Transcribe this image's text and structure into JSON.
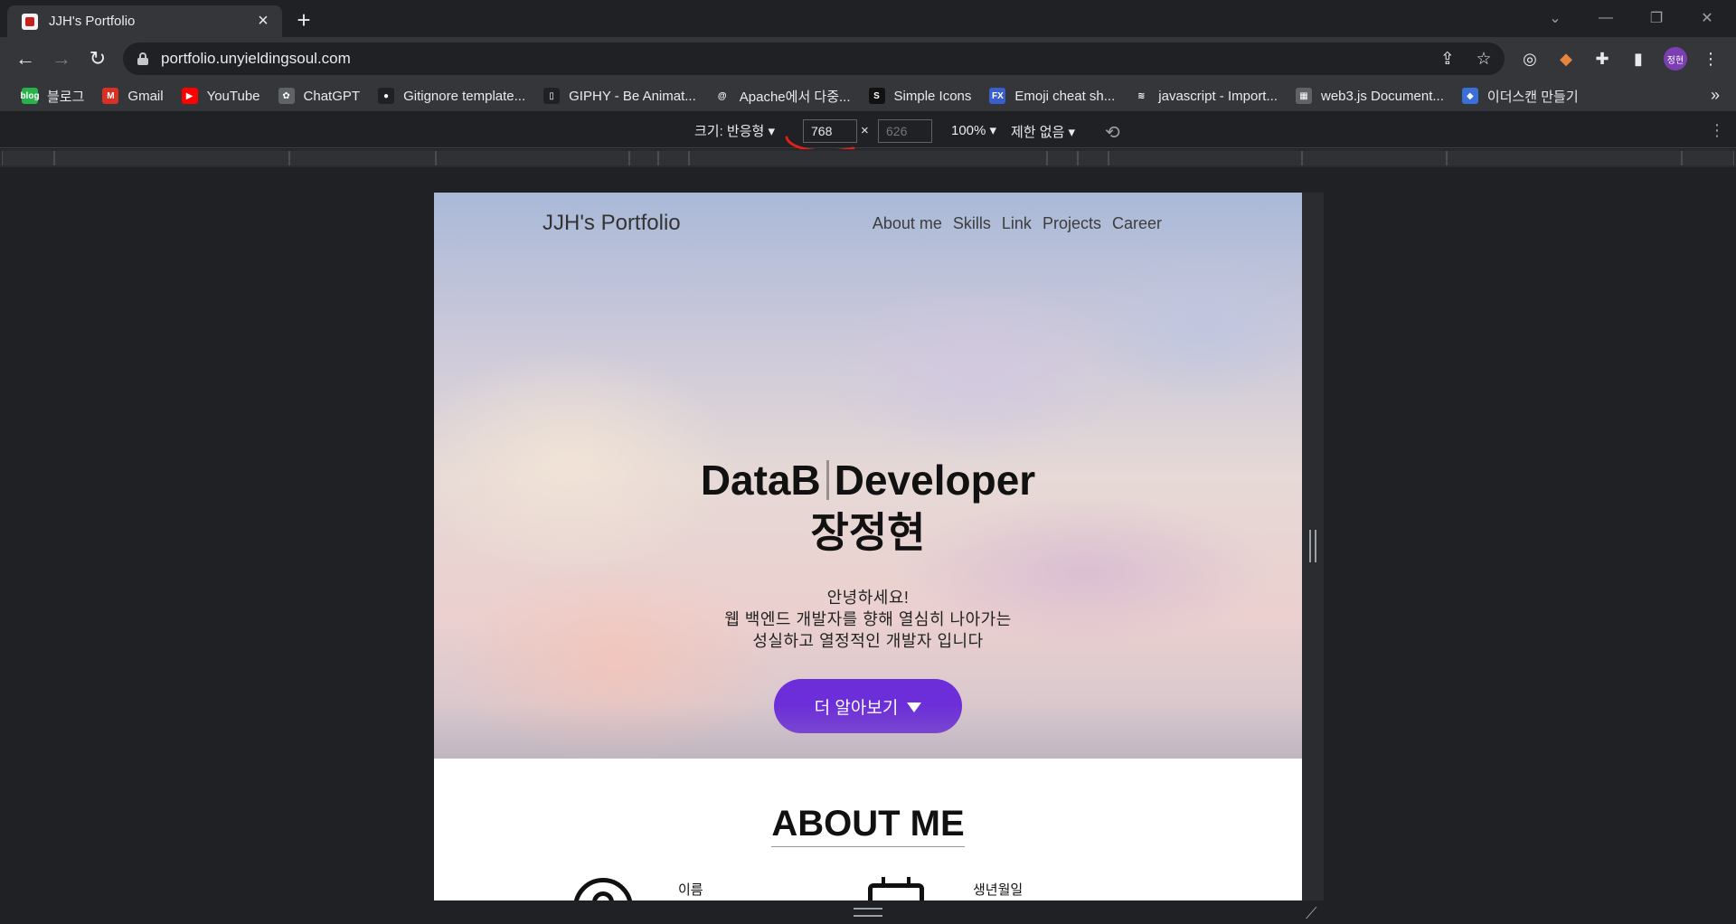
{
  "browser": {
    "tab_title": "JJH's Portfolio",
    "url": "portfolio.unyieldingsoul.com",
    "profile_initials": "정현",
    "bookmarks": [
      {
        "label": "블로그",
        "icon": "blog-icon",
        "color": "#27b24b",
        "glyph": "blog"
      },
      {
        "label": "Gmail",
        "icon": "gmail-icon",
        "color": "#d93025",
        "glyph": "M"
      },
      {
        "label": "YouTube",
        "icon": "youtube-icon",
        "color": "#ff0000",
        "glyph": "▶"
      },
      {
        "label": "ChatGPT",
        "icon": "chatgpt-icon",
        "color": "#5f6368",
        "glyph": "✿"
      },
      {
        "label": "Gitignore template...",
        "icon": "github-icon",
        "color": "#202124",
        "glyph": "●"
      },
      {
        "label": "GIPHY - Be Animat...",
        "icon": "giphy-icon",
        "color": "#202124",
        "glyph": "▯"
      },
      {
        "label": "Apache에서 다중...",
        "icon": "at-icon",
        "color": "#35363a",
        "glyph": "@"
      },
      {
        "label": "Simple Icons",
        "icon": "simpleicons-icon",
        "color": "#111111",
        "glyph": "S"
      },
      {
        "label": "Emoji cheat sh...",
        "icon": "fx-icon",
        "color": "#3a5fcd",
        "glyph": "FX"
      },
      {
        "label": "javascript - Import...",
        "icon": "stackoverflow-icon",
        "color": "#35363a",
        "glyph": "≋"
      },
      {
        "label": "web3.js Document...",
        "icon": "docs-icon",
        "color": "#5f6368",
        "glyph": "▦"
      },
      {
        "label": "이더스캔 만들기",
        "icon": "cube-icon",
        "color": "#3b6fd8",
        "glyph": "◆"
      }
    ]
  },
  "devtools": {
    "size_label": "크기: 반응형",
    "width_value": "768",
    "height_placeholder": "626",
    "times": "×",
    "zoom_label": "100%",
    "throttle_label": "제한 없음"
  },
  "page": {
    "logo": "JJH's Portfolio",
    "nav": [
      "About me",
      "Skills",
      "Link",
      "Projects",
      "Career"
    ],
    "headline_left": "DataB",
    "headline_right": "Developer",
    "name": "장정현",
    "intro_lines": [
      "안녕하세요!",
      "웹 백엔드 개발자를 향해 열심히 나아가는",
      "성실하고 열정적인 개발자 입니다"
    ],
    "cta_label": "더 알아보기",
    "about_title": "ABOUT ME",
    "about_name_label": "이름",
    "about_birth_label": "생년월일",
    "accent_color": "#6c2ed9"
  }
}
